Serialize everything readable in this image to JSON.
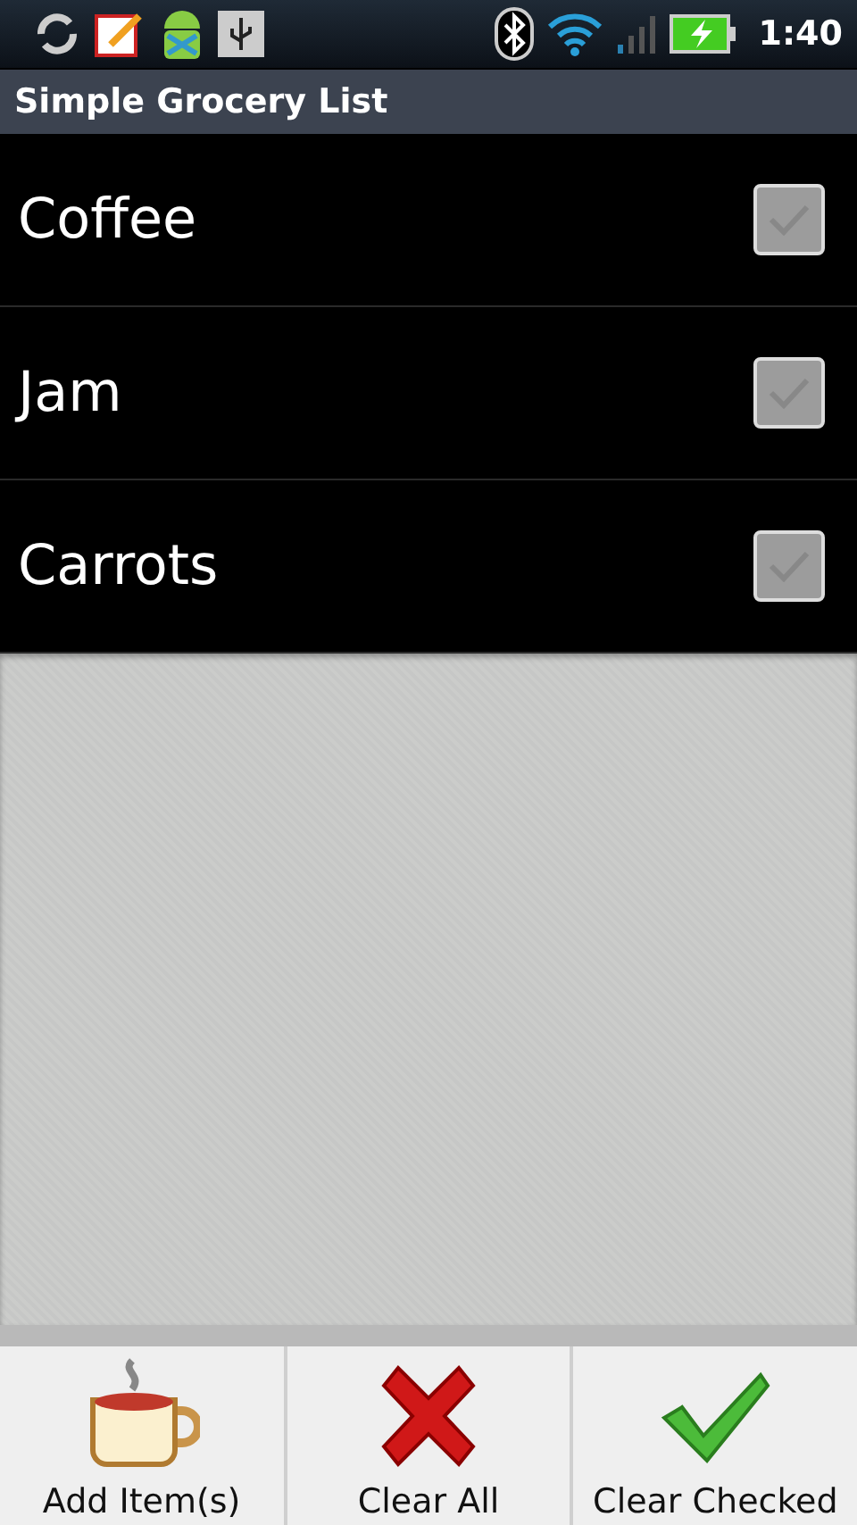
{
  "status_bar": {
    "time": "1:40"
  },
  "title_bar": {
    "title": "Simple Grocery List"
  },
  "items": [
    {
      "label": "Coffee",
      "checked": false
    },
    {
      "label": "Jam",
      "checked": false
    },
    {
      "label": "Carrots",
      "checked": false
    }
  ],
  "buttons": [
    {
      "kind": "add",
      "label": "Add Item(s)"
    },
    {
      "kind": "clear_all",
      "label": "Clear All"
    },
    {
      "kind": "clear_checked",
      "label": "Clear Checked"
    }
  ]
}
